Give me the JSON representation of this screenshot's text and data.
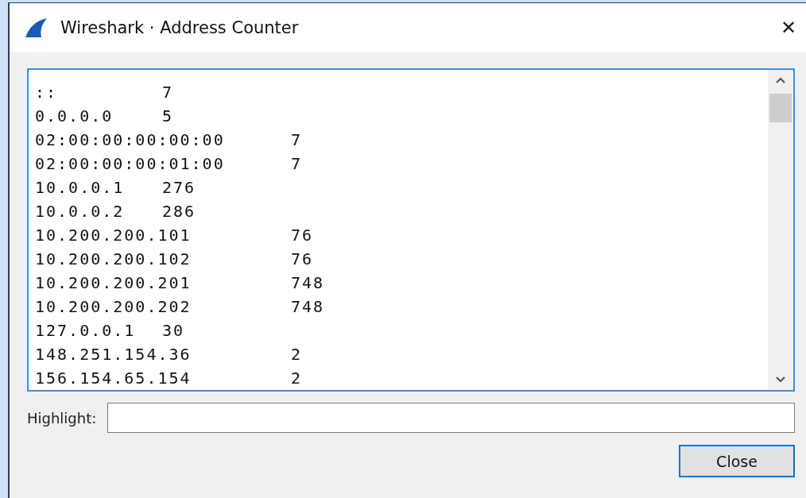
{
  "window": {
    "title": "Wireshark · Address Counter",
    "close_glyph": "✕"
  },
  "output": {
    "lines": [
      {
        "address": "::",
        "count": "7"
      },
      {
        "address": "0.0.0.0",
        "count": "5"
      },
      {
        "address": "02:00:00:00:00:00",
        "count": "7"
      },
      {
        "address": "02:00:00:00:01:00",
        "count": "7"
      },
      {
        "address": "10.0.0.1",
        "count": "276"
      },
      {
        "address": "10.0.0.2",
        "count": "286"
      },
      {
        "address": "10.200.200.101",
        "count": "76"
      },
      {
        "address": "10.200.200.102",
        "count": "76"
      },
      {
        "address": "10.200.200.201",
        "count": "748"
      },
      {
        "address": "10.200.200.202",
        "count": "748"
      },
      {
        "address": "127.0.0.1",
        "count": "30"
      },
      {
        "address": "148.251.154.36",
        "count": "2"
      },
      {
        "address": "156.154.65.154",
        "count": "2"
      }
    ]
  },
  "highlight": {
    "label": "Highlight:"
  },
  "buttons": [
    {
      "label": "Close"
    }
  ]
}
